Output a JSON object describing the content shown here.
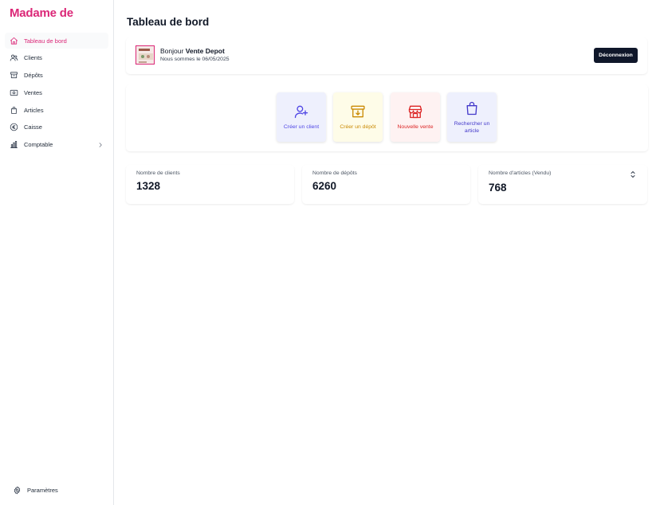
{
  "brand": "Madame de",
  "sidebar": {
    "items": [
      {
        "label": "Tableau de bord"
      },
      {
        "label": "Clients"
      },
      {
        "label": "Dépôts"
      },
      {
        "label": "Ventes"
      },
      {
        "label": "Articles"
      },
      {
        "label": "Caisse"
      },
      {
        "label": "Comptable"
      }
    ],
    "settings_label": "Paramètres"
  },
  "header": {
    "title": "Tableau de bord"
  },
  "welcome": {
    "greeting": "Bonjour",
    "user_name": "Vente Depot",
    "date_line": "Nous sommes le 06/05/2025",
    "logout_label": "Déconnexion"
  },
  "quick_actions": [
    {
      "label": "Créer un client",
      "bg": "#eef0fd",
      "color": "#4f46e5"
    },
    {
      "label": "Créer un dépôt",
      "bg": "#fefce8",
      "color": "#ca8a04"
    },
    {
      "label": "Nouvelle vente",
      "bg": "#fef2f2",
      "color": "#dc2626"
    },
    {
      "label": "Rechercher un article",
      "bg": "#eef0fd",
      "color": "#4338ca"
    }
  ],
  "stats": [
    {
      "label": "Nombre de clients",
      "value": "1328"
    },
    {
      "label": "Nombre de dépôts",
      "value": "6260"
    },
    {
      "label": "Nombre d'articles (Vendu)",
      "value": "768"
    }
  ],
  "colors": {
    "accent": "#db2777",
    "button_dark": "#0f172a"
  }
}
